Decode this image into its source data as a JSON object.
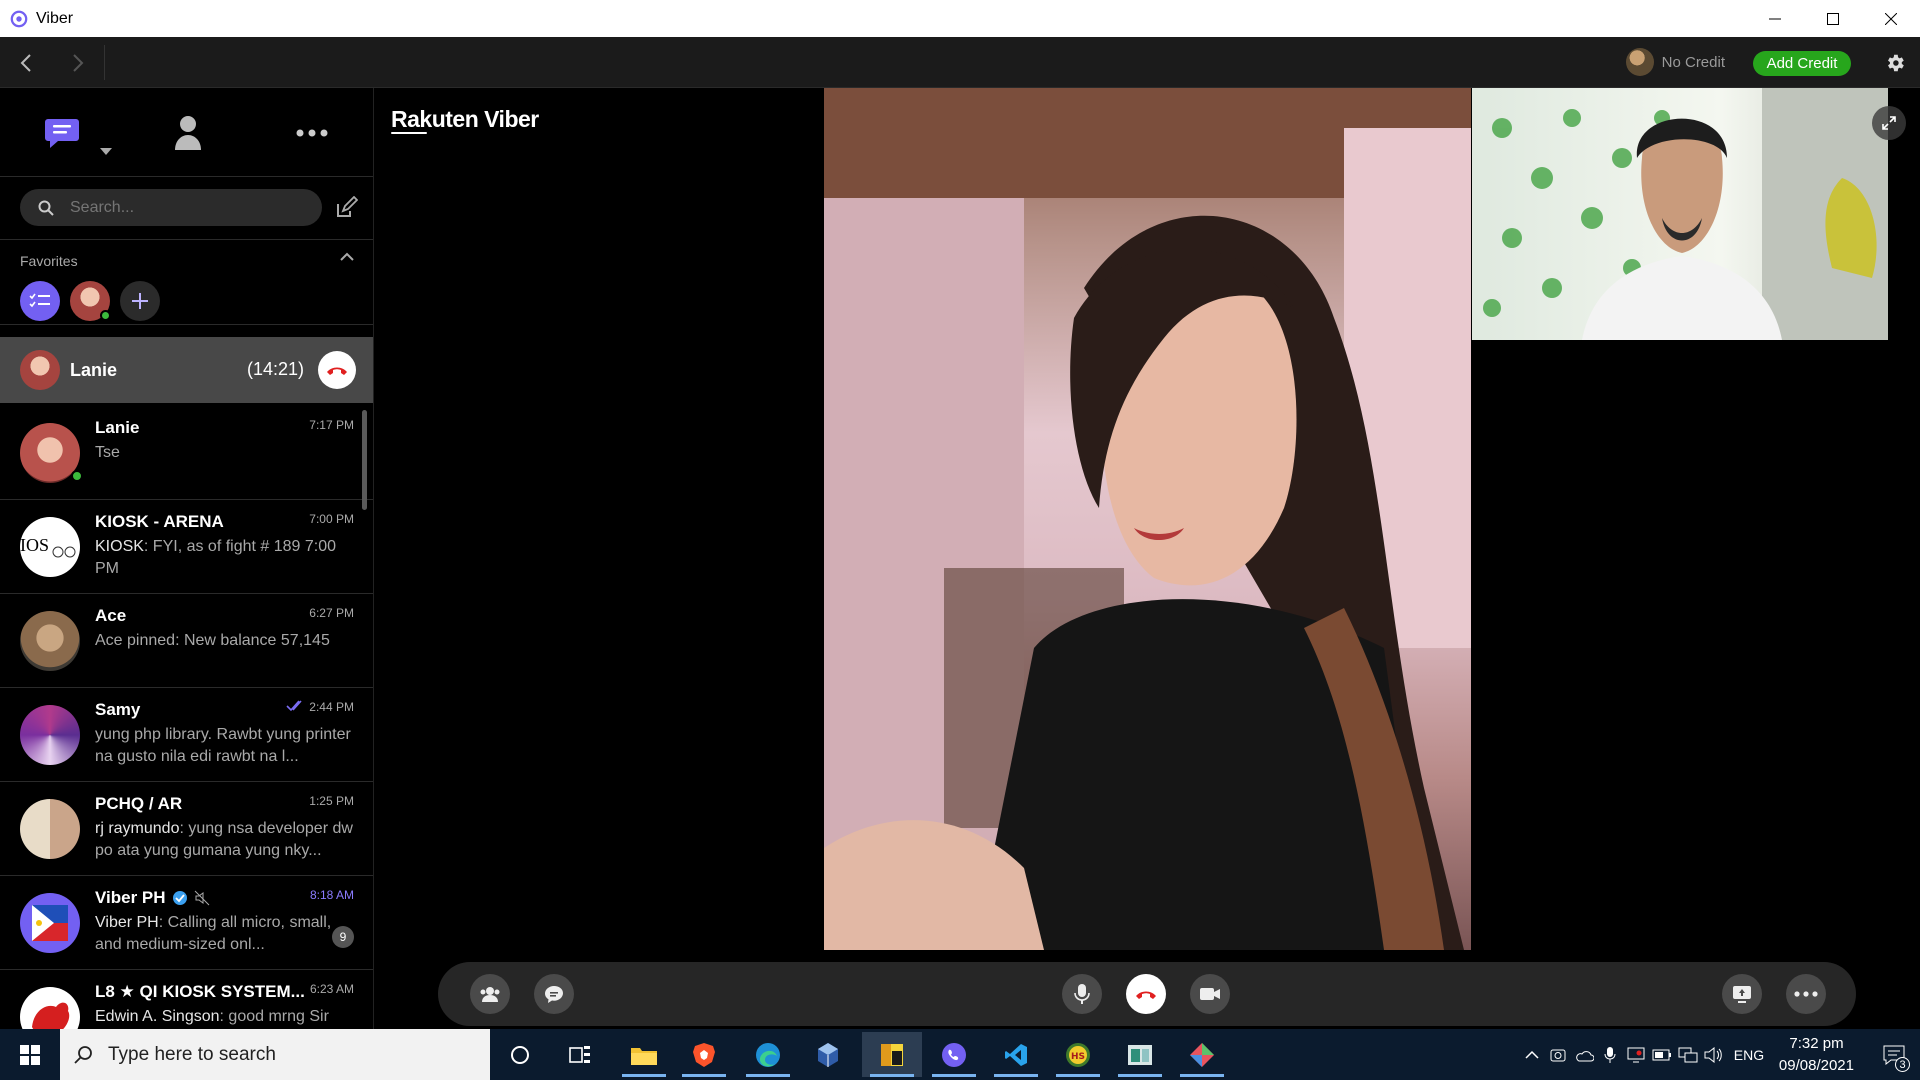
{
  "window": {
    "title": "Viber"
  },
  "toolbar": {
    "credit_label": "No Credit",
    "add_credit_label": "Add Credit"
  },
  "sidebar": {
    "search_placeholder": "Search...",
    "favorites_label": "Favorites",
    "active_call": {
      "name": "Lanie",
      "duration": "(14:21)"
    },
    "chats": [
      {
        "name": "Lanie",
        "time": "7:17 PM",
        "message": "Tse",
        "online": true
      },
      {
        "name": "KIOSK - ARENA",
        "time": "7:00 PM",
        "sender": "KIOSK",
        "message": ": FYI, as of fight # 189 7:00 PM"
      },
      {
        "name": "Ace",
        "time": "6:27 PM",
        "message": "Ace pinned: New balance 57,145"
      },
      {
        "name": "Samy",
        "time": "2:44 PM",
        "message": "yung php library. Rawbt yung printer na gusto nila edi rawbt na l..."
      },
      {
        "name": "PCHQ / AR",
        "time": "1:25 PM",
        "sender": "rj raymundo",
        "message": ": yung nsa developer dw po ata yung gumana yung nky..."
      },
      {
        "name": "Viber PH",
        "time": "8:18 AM",
        "sender": "Viber PH",
        "message": ": Calling all micro, small, and medium-sized onl...",
        "badge": "9"
      },
      {
        "name": "L8 ★ QI KIOSK SYSTEM...",
        "time": "6:23 AM",
        "sender": "Edwin A. Singson",
        "message": ": good mrng Sir"
      }
    ]
  },
  "main": {
    "logo": "Rakuten Viber"
  },
  "taskbar": {
    "search_placeholder": "Type here to search",
    "language": "ENG",
    "time": "7:32 pm",
    "date": "09/08/2021",
    "notification_count": "3"
  },
  "colors": {
    "viber_purple": "#7360f2",
    "add_credit_green": "#27a61c",
    "end_call_red": "#e02020"
  }
}
